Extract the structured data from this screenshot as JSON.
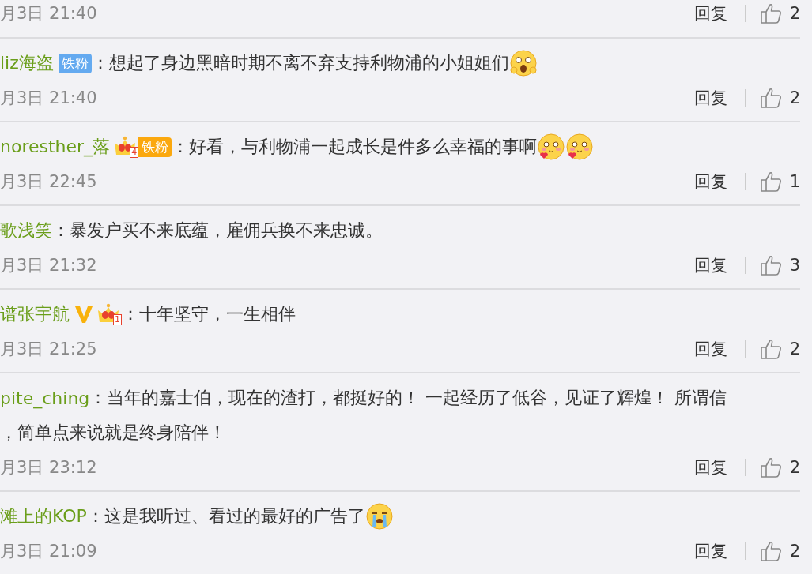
{
  "comments": [
    {
      "date": "月3日 21:40",
      "reply": "回复",
      "likes": "2"
    },
    {
      "user": "liz海盗",
      "badges": [
        {
          "kind": "fan",
          "text": "铁粉"
        }
      ],
      "text_lines": [
        "：想起了身边黑暗时期不离不弃支持利物浦的小姐姐们"
      ],
      "emojis": [
        {
          "kind": "surprised"
        }
      ],
      "date": "月3日 21:40",
      "reply": "回复",
      "likes": "2"
    },
    {
      "user": "noresther_落",
      "badges": [
        {
          "kind": "crown_fan",
          "level": "4",
          "text": "铁粉"
        }
      ],
      "text_lines": [
        "：好看，与利物浦一起成长是件多么幸福的事啊"
      ],
      "emojis": [
        {
          "kind": "blush"
        },
        {
          "kind": "blush"
        }
      ],
      "date": "月3日 22:45",
      "reply": "回复",
      "likes": "1"
    },
    {
      "user": "歌浅笑",
      "text_lines": [
        "：暴发户买不来底蕴，雇佣兵换不来忠诚。"
      ],
      "date": "月3日 21:32",
      "reply": "回复",
      "likes": "3"
    },
    {
      "user": "谱张宇航",
      "badges": [
        {
          "kind": "verified"
        },
        {
          "kind": "crown",
          "level": "1"
        }
      ],
      "text_lines": [
        "：十年坚守，一生相伴"
      ],
      "date": "月3日 21:25",
      "reply": "回复",
      "likes": "2"
    },
    {
      "user": "pite_ching",
      "text_lines": [
        "：当年的嘉士伯，现在的渣打，都挺好的！ 一起经历了低谷，见证了辉煌！ 所谓信",
        "，简单点来说就是终身陪伴！"
      ],
      "date": "月3日 23:12",
      "reply": "回复",
      "likes": "2"
    },
    {
      "user": "滩上的KOP",
      "text_lines": [
        "：这是我听过、看过的最好的广告了"
      ],
      "emojis": [
        {
          "kind": "crying"
        }
      ],
      "date": "月3日 21:09",
      "reply": "回复",
      "likes": "2"
    }
  ]
}
